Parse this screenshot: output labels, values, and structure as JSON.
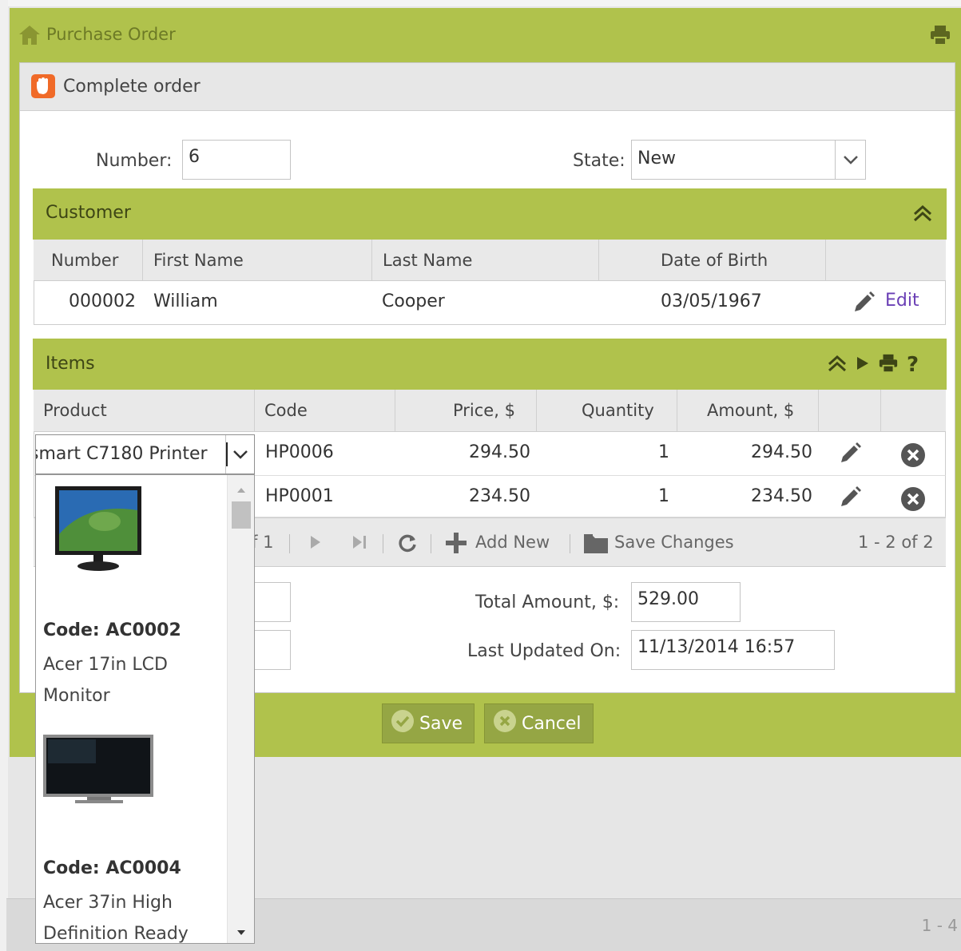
{
  "window": {
    "title": "Purchase Order"
  },
  "dialog": {
    "title": "Complete order"
  },
  "form": {
    "number_label": "Number:",
    "number_value": "6",
    "state_label": "State:",
    "state_value": "New",
    "total_label": "Total Amount, $:",
    "total_value": "529.00",
    "updated_label": "Last Updated On:",
    "updated_value": "11/13/2014 16:57"
  },
  "customer": {
    "title": "Customer",
    "columns": [
      "Number",
      "First Name",
      "Last Name",
      "Date of Birth"
    ],
    "row": {
      "number": "000002",
      "first_name": "William",
      "last_name": "Cooper",
      "dob": "03/05/1967",
      "edit_label": "Edit"
    }
  },
  "items": {
    "title": "Items",
    "columns": [
      "Product",
      "Code",
      "Price, $",
      "Quantity",
      "Amount, $"
    ],
    "rows": [
      {
        "product": "smart C7180 Printer",
        "code": "HP0006",
        "price": "294.50",
        "quantity": "1",
        "amount": "294.50"
      },
      {
        "product": "",
        "code": "HP0001",
        "price": "234.50",
        "quantity": "1",
        "amount": "234.50"
      }
    ],
    "pager": {
      "page_of": "f 1",
      "add_new": "Add New",
      "save_changes": "Save Changes",
      "range": "1 - 2 of 2"
    }
  },
  "dropdown": {
    "options": [
      {
        "code": "Code: AC0002",
        "name": "Acer 17in LCD Monitor"
      },
      {
        "code": "Code: AC0004",
        "name": "Acer 37in High Definition Ready"
      }
    ]
  },
  "buttons": {
    "save": "Save",
    "cancel": "Cancel"
  },
  "background": {
    "pager_text": "1 - 4"
  },
  "colors": {
    "accent": "#b0c24c",
    "button": "#95a644",
    "hand_icon": "#f06a28",
    "edit_link": "#6a3fb5"
  }
}
